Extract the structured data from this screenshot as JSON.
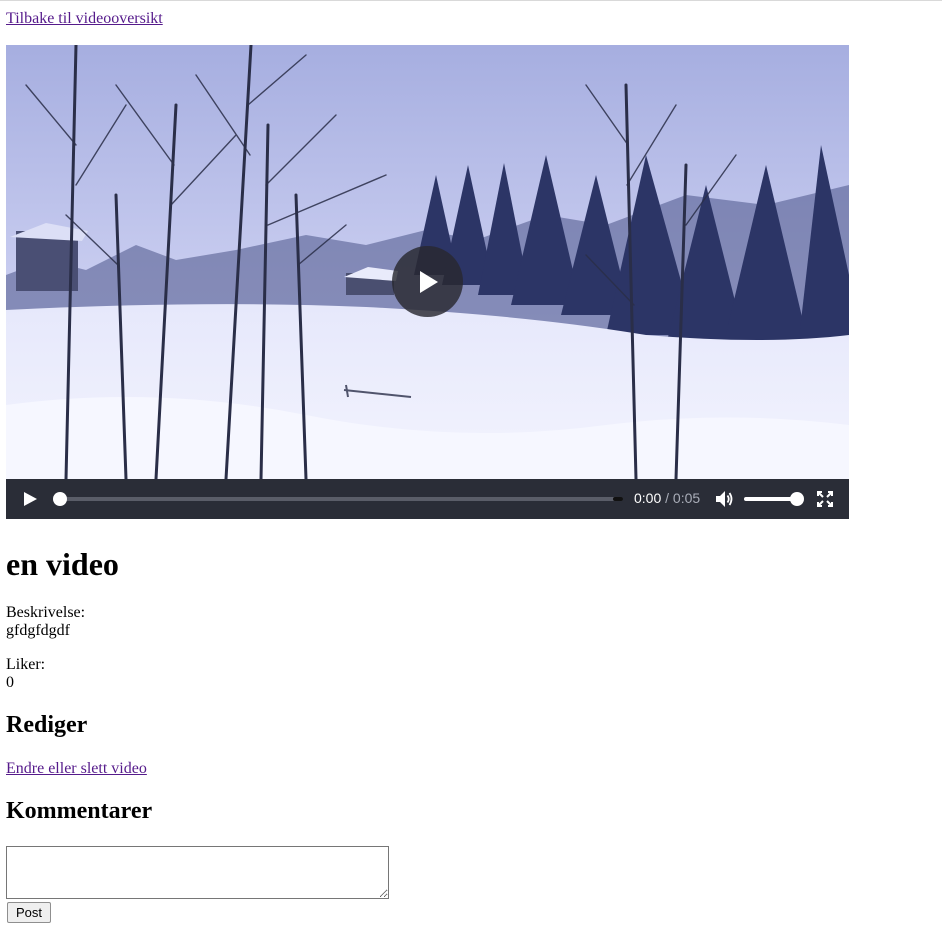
{
  "nav": {
    "back_label": "Tilbake til videooversikt"
  },
  "video": {
    "current_time": "0:00",
    "separator": "/",
    "duration": "0:05",
    "progress_fraction": 0,
    "volume_fraction": 1
  },
  "title": "en video",
  "description": {
    "label": "Beskrivelse:",
    "value": "gfdgfdgdf"
  },
  "likes": {
    "label": "Liker:",
    "value": "0"
  },
  "edit_section": {
    "heading": "Rediger",
    "link_label": "Endre eller slett video"
  },
  "comments": {
    "heading": "Kommentarer",
    "input_value": "",
    "post_label": "Post"
  },
  "colors": {
    "link": "#551a8b",
    "control_bar": "#2d303a"
  }
}
